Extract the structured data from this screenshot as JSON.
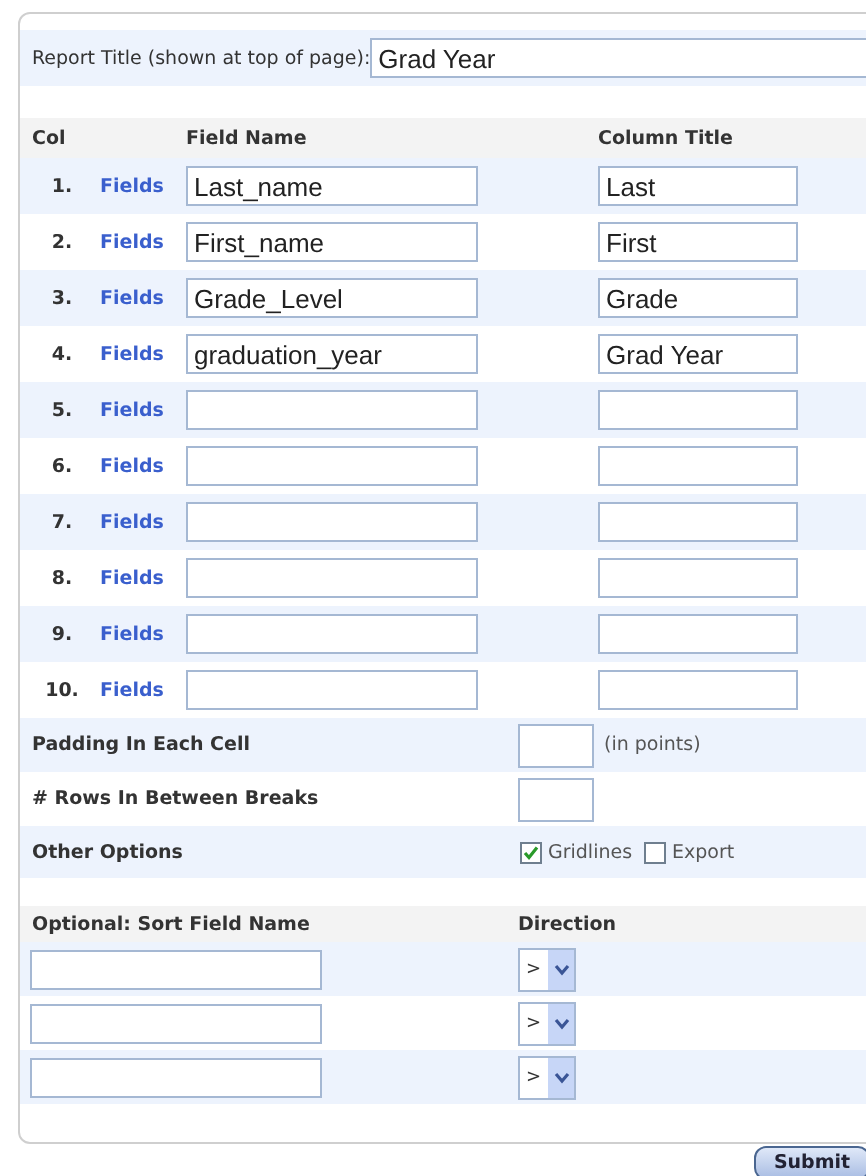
{
  "report_title": {
    "label": "Report Title (shown at top of page):",
    "value": "Grad Year"
  },
  "columns_table": {
    "headers": [
      "Col",
      "Field Name",
      "Column Title"
    ],
    "rows": [
      {
        "number": "1.",
        "link": "Fields",
        "field_name": "Last_name",
        "column_title": "Last"
      },
      {
        "number": "2.",
        "link": "Fields",
        "field_name": "First_name",
        "column_title": "First"
      },
      {
        "number": "3.",
        "link": "Fields",
        "field_name": "Grade_Level",
        "column_title": "Grade"
      },
      {
        "number": "4.",
        "link": "Fields",
        "field_name": "graduation_year",
        "column_title": "Grad Year"
      },
      {
        "number": "5.",
        "link": "Fields"
      },
      {
        "number": "6.",
        "link": "Fields"
      },
      {
        "number": "7.",
        "link": "Fields"
      },
      {
        "number": "8.",
        "link": "Fields"
      },
      {
        "number": "9.",
        "link": "Fields"
      },
      {
        "number": "10.",
        "link": "Fields"
      }
    ]
  },
  "options": {
    "padding": {
      "label": "Padding In Each Cell",
      "unit": "(in points)"
    },
    "rows_between_breaks": {
      "label": "# Rows In Between Breaks"
    },
    "other": {
      "label": "Other Options",
      "checkboxes": [
        {
          "label": "Gridlines",
          "checked": true
        },
        {
          "label": "Export",
          "checked": false
        }
      ]
    }
  },
  "sort": {
    "headers": [
      "Optional: Sort Field Name",
      "Direction"
    ],
    "rows": [
      {
        "direction": ">"
      },
      {
        "direction": ">"
      },
      {
        "direction": ">"
      }
    ]
  },
  "submit": "Submit"
}
